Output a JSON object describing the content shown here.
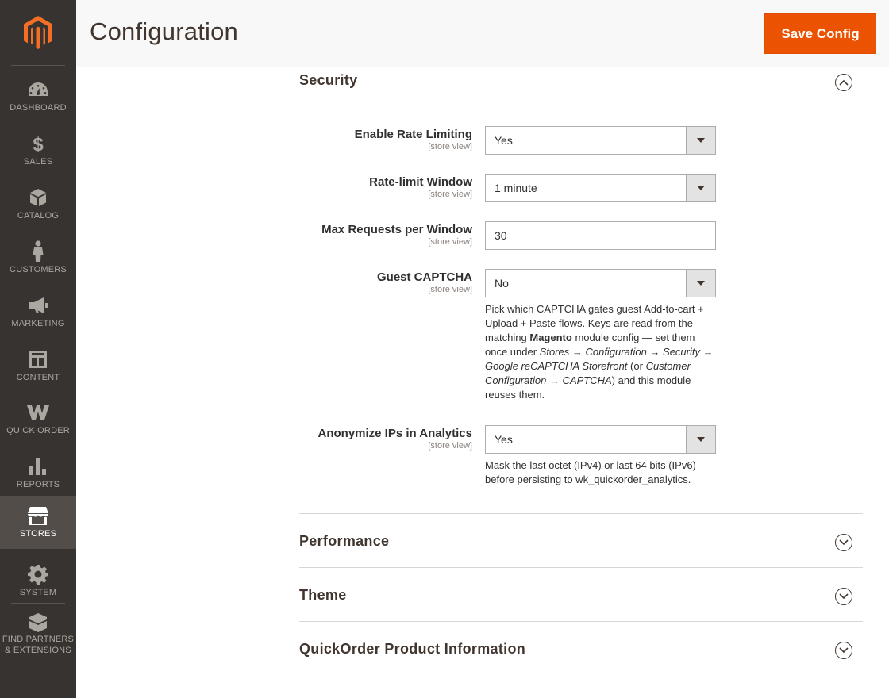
{
  "header": {
    "title": "Configuration",
    "save_label": "Save Config"
  },
  "nav": [
    {
      "label": "DASHBOARD",
      "icon": "dashboard-icon"
    },
    {
      "label": "SALES",
      "icon": "dollar-icon"
    },
    {
      "label": "CATALOG",
      "icon": "box-icon"
    },
    {
      "label": "CUSTOMERS",
      "icon": "person-icon"
    },
    {
      "label": "MARKETING",
      "icon": "megaphone-icon"
    },
    {
      "label": "CONTENT",
      "icon": "layout-icon"
    },
    {
      "label": "QUICK ORDER",
      "icon": "quickorder-icon"
    },
    {
      "label": "REPORTS",
      "icon": "bar-chart-icon"
    },
    {
      "label": "STORES",
      "icon": "storefront-icon",
      "active": true
    },
    {
      "label": "SYSTEM",
      "icon": "gear-icon"
    },
    {
      "label": "FIND PARTNERS",
      "label2": "& EXTENSIONS",
      "icon": "extensions-icon"
    }
  ],
  "security": {
    "title": "Security",
    "fields": {
      "rate_limiting": {
        "label": "Enable Rate Limiting",
        "scope": "[store view]",
        "value": "Yes"
      },
      "window": {
        "label": "Rate-limit Window",
        "scope": "[store view]",
        "value": "1 minute"
      },
      "max_requests": {
        "label": "Max Requests per Window",
        "scope": "[store view]",
        "value": "30"
      },
      "captcha": {
        "label": "Guest CAPTCHA",
        "scope": "[store view]",
        "value": "No",
        "note": {
          "t1": "Pick which CAPTCHA gates guest Add-to-cart + Upload + Paste flows. Keys are read from the matching ",
          "b1": "Magento",
          "t2": " module config — set them once under ",
          "i1": "Stores → Configuration → Security → Google reCAPTCHA Storefront",
          "t3": " (or ",
          "i2": "Customer Configuration → CAPTCHA",
          "t4": ") and this module reuses them."
        }
      },
      "anonymize": {
        "label": "Anonymize IPs in Analytics",
        "scope": "[store view]",
        "value": "Yes",
        "note": "Mask the last octet (IPv4) or last 64 bits (IPv6) before persisting to wk_quickorder_analytics."
      }
    }
  },
  "sections": {
    "performance": "Performance",
    "theme": "Theme",
    "product_info": "QuickOrder Product Information"
  },
  "colors": {
    "accent": "#eb5202",
    "sidebar": "#373330",
    "sidebar_active": "#524d49"
  }
}
